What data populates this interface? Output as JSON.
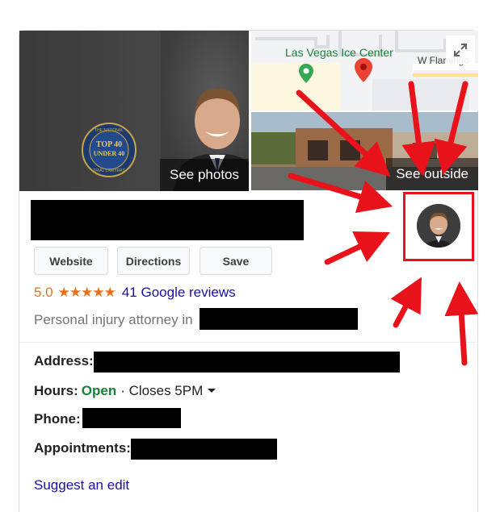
{
  "photos": {
    "main_caption": "See photos",
    "badge_text": [
      "THE NATIONAL",
      "TOP 40",
      "UNDER 40",
      "TRIAL LAWYERS"
    ],
    "map": {
      "place_label": "Las Vegas Ice Center",
      "road_label": "W Flamingo"
    },
    "street_caption": "See outside"
  },
  "actions": {
    "website": "Website",
    "directions": "Directions",
    "save": "Save"
  },
  "rating": {
    "score": "5.0",
    "stars": "★★★★★",
    "reviews": "41 Google reviews"
  },
  "category_prefix": "Personal injury attorney in",
  "info": {
    "address_label": "Address:",
    "hours_label": "Hours:",
    "hours_status": "Open",
    "hours_detail": "· Closes 5PM",
    "phone_label": "Phone:",
    "appointments_label": "Appointments:"
  },
  "suggest_edit": "Suggest an edit",
  "colors": {
    "annotation_red": "#e8131a",
    "open_green": "#188038",
    "link_blue": "#1a0dab",
    "star_orange": "#e7711b"
  }
}
